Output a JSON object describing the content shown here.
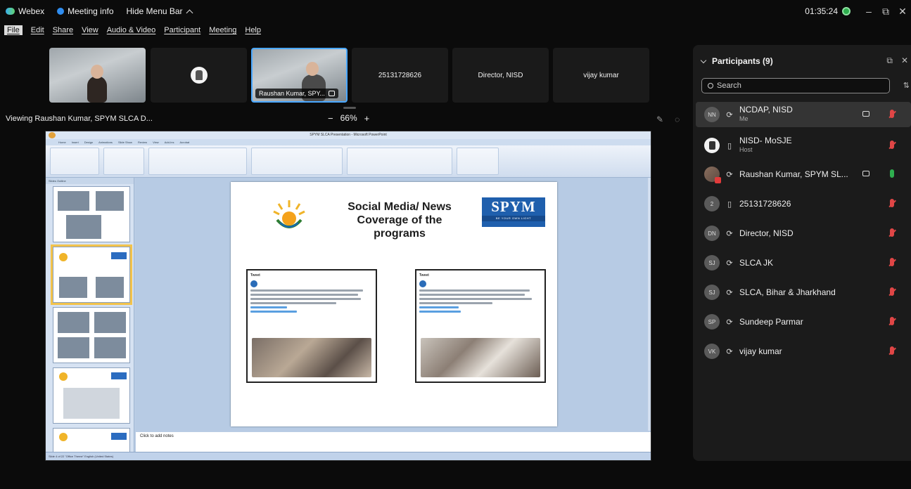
{
  "topbar": {
    "app_name": "Webex",
    "meeting_info": "Meeting info",
    "hide_menu": "Hide Menu Bar",
    "timer": "01:35:24",
    "minimize": "–",
    "restore": "⧉",
    "close": "✕"
  },
  "menu": [
    "File",
    "Edit",
    "Share",
    "View",
    "Audio & Video",
    "Participant",
    "Meeting",
    "Help"
  ],
  "video_strip": {
    "tile_active_name": "Raushan Kumar, SPY...",
    "tile4": "25131728626",
    "tile5": "Director, NISD",
    "tile6": "vijay kumar"
  },
  "share": {
    "viewing": "Viewing Raushan Kumar, SPYM SLCA D...",
    "zoom_minus": "−",
    "zoom_level": "66%",
    "zoom_plus": "+"
  },
  "ppt": {
    "window_title": "SPYM SLCA Presentation - Microsoft PowerPoint",
    "tabs": [
      "Home",
      "Insert",
      "Design",
      "Animations",
      "Slide Show",
      "Review",
      "View",
      "Add-Ins",
      "Acrobat"
    ],
    "thumb_tabs": "Slides   Outline",
    "slide_title": "Social Media/ News Coverage of the programs",
    "spym_logo": "SPYM",
    "spym_tagline": "BE YOUR OWN LIGHT",
    "tweet_header": "Tweet",
    "notes": "Click to add notes",
    "status": "Slide 4 of 22    \"Office Theme\"    English (United States)"
  },
  "panel": {
    "title": "Participants (9)",
    "search_placeholder": "Search",
    "participants": [
      {
        "initials": "NN",
        "name": "NCDAP, NISD",
        "sub": "Me",
        "device": "⟳",
        "cam": true,
        "mic": "muted"
      },
      {
        "initials": "",
        "name": "NISD- MoSJE",
        "sub": "Host",
        "device": "▯",
        "cam": false,
        "mic": "muted"
      },
      {
        "initials": "",
        "name": "Raushan Kumar, SPYM SL...",
        "sub": "",
        "device": "⟳",
        "cam": true,
        "mic": "on"
      },
      {
        "initials": "2",
        "name": "25131728626",
        "sub": "",
        "device": "▯",
        "cam": false,
        "mic": "muted"
      },
      {
        "initials": "DN",
        "name": "Director, NISD",
        "sub": "",
        "device": "⟳",
        "cam": false,
        "mic": "muted"
      },
      {
        "initials": "SJ",
        "name": "SLCA JK",
        "sub": "",
        "device": "⟳",
        "cam": false,
        "mic": "muted"
      },
      {
        "initials": "SJ",
        "name": "SLCA, Bihar & Jharkhand",
        "sub": "",
        "device": "⟳",
        "cam": false,
        "mic": "muted"
      },
      {
        "initials": "SP",
        "name": "Sundeep Parmar",
        "sub": "",
        "device": "⟳",
        "cam": false,
        "mic": "muted"
      },
      {
        "initials": "VK",
        "name": "vijay kumar",
        "sub": "",
        "device": "⟳",
        "cam": false,
        "mic": "muted"
      }
    ]
  },
  "colors": {
    "accent_blue": "#4aa8ff",
    "recording_green": "#2fae4f",
    "mute_red": "#e04646",
    "spym_blue": "#1f5fad"
  }
}
